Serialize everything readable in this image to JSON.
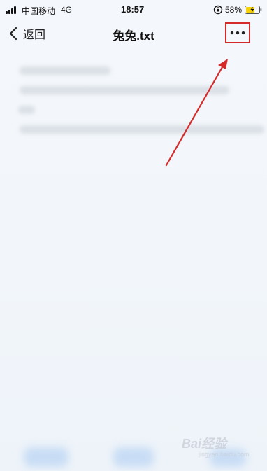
{
  "status_bar": {
    "carrier": "中国移动",
    "network": "4G",
    "time": "18:57",
    "battery_percent": "58%",
    "icons": [
      "signal-icon",
      "orientation-lock-icon",
      "battery-charging-icon"
    ]
  },
  "nav": {
    "back_label": "返回",
    "title": "兔兔.txt",
    "more_icon": "more-dots-icon"
  },
  "watermark": {
    "text": "Bai经验",
    "sub": "jingyan.baidu.com"
  },
  "colors": {
    "annotation_red": "#d42a2a",
    "battery_yellow": "#f5d100",
    "toolbar_blue": "#b7d3f3"
  }
}
